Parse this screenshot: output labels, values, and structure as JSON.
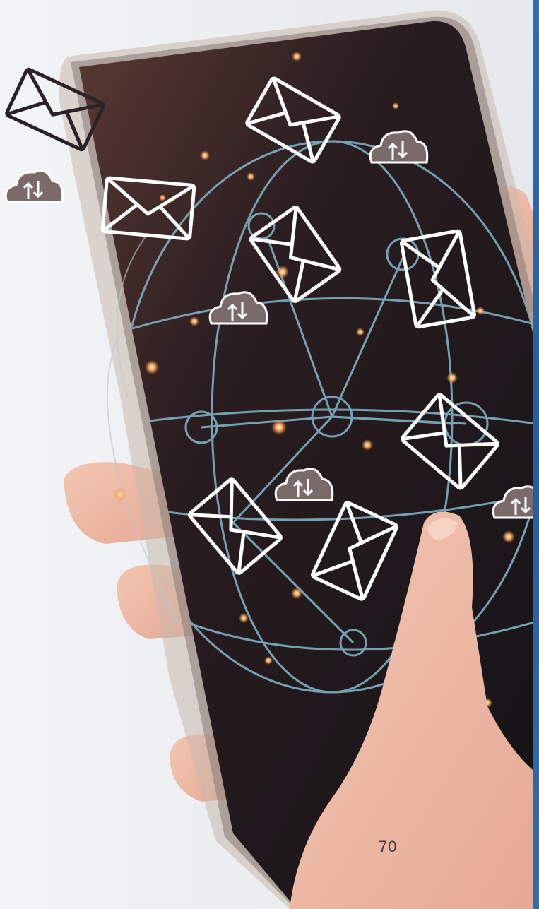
{
  "page": {
    "number": "70",
    "accent_color": "#1d5fa6"
  },
  "scene": {
    "icons": [
      "envelope-icon",
      "cloud-sync-icon"
    ]
  }
}
